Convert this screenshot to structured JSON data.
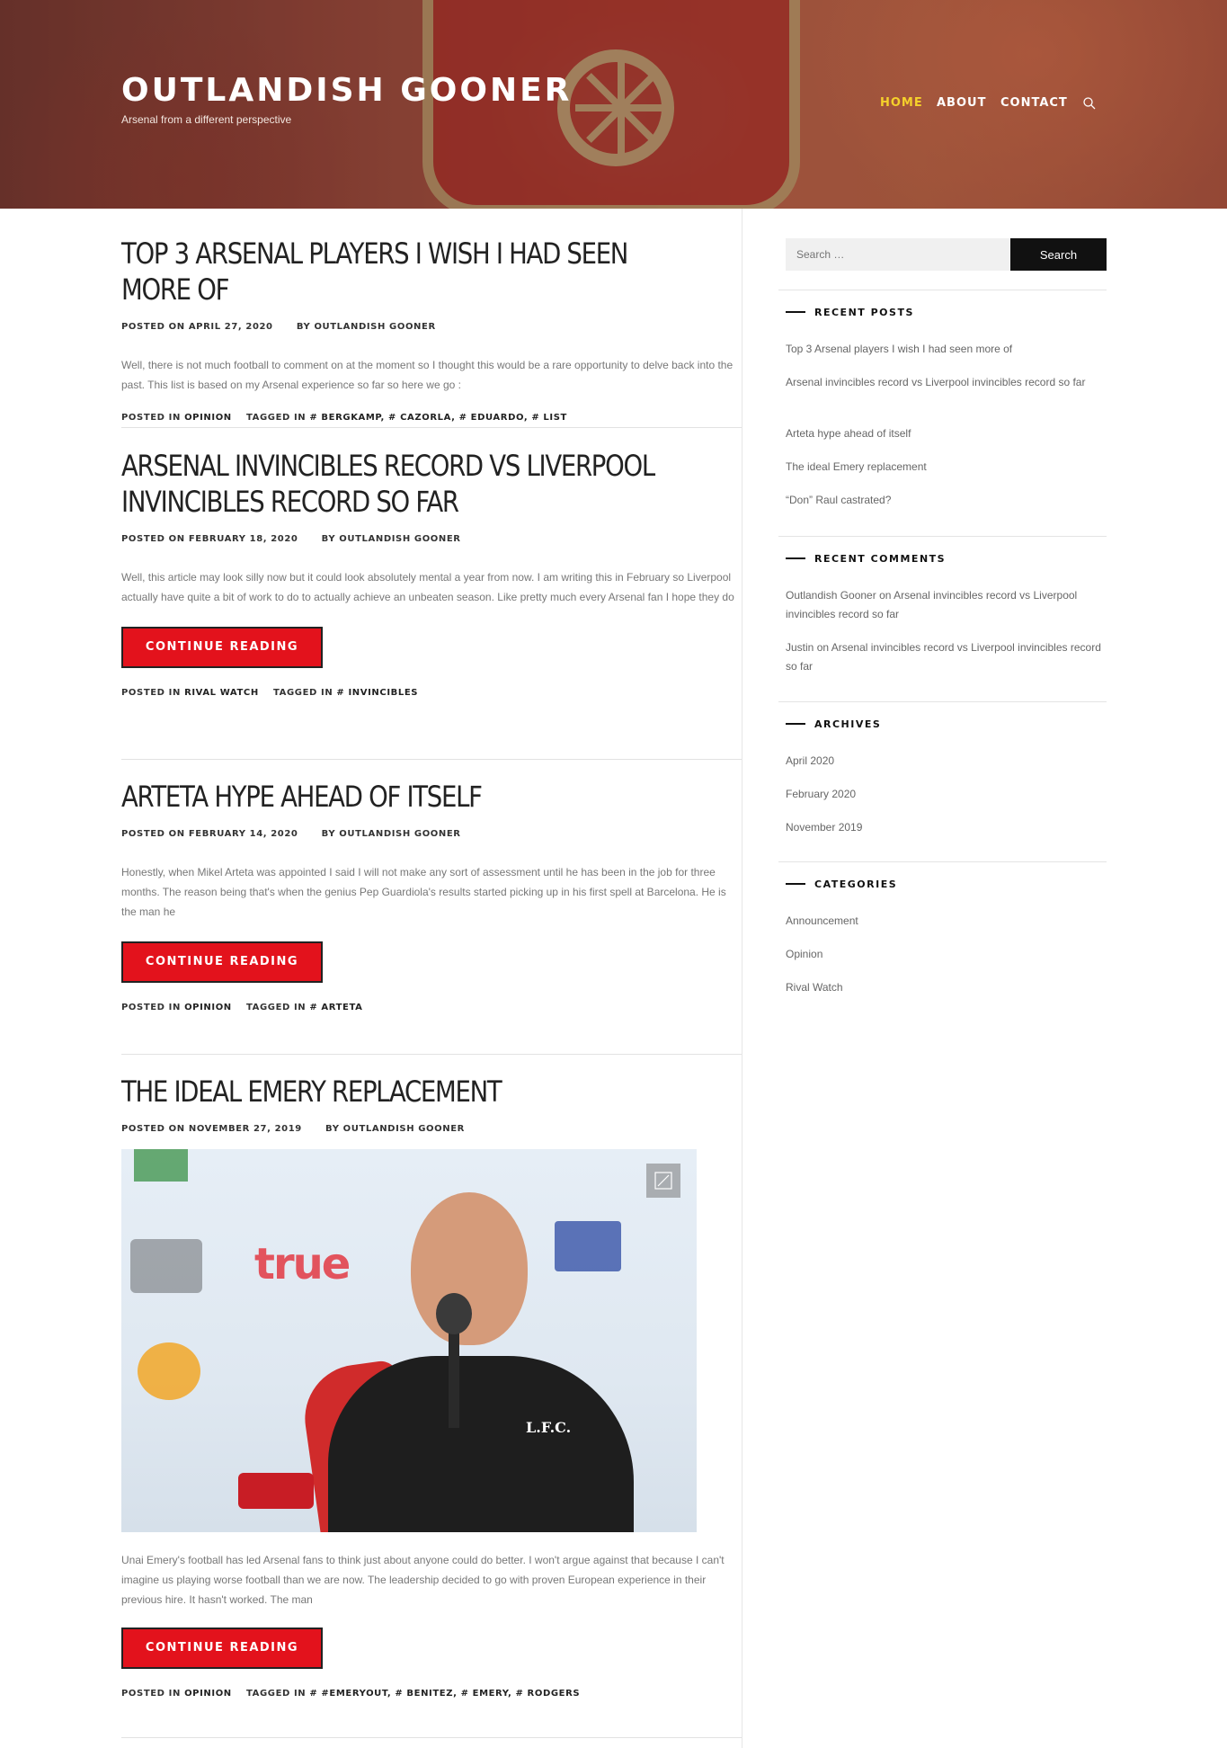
{
  "site": {
    "title": "OUTLANDISH GOONER",
    "tagline": "Arsenal from a different perspective"
  },
  "nav": {
    "items": [
      {
        "label": "HOME",
        "active": true
      },
      {
        "label": "ABOUT",
        "active": false
      },
      {
        "label": "CONTACT",
        "active": false
      }
    ],
    "search_icon": "search-icon",
    "active_color": "#f5d12b"
  },
  "posts": [
    {
      "title": "TOP 3 ARSENAL PLAYERS I WISH I HAD SEEN MORE OF",
      "posted_on_label": "POSTED ON",
      "date": "APRIL 27, 2020",
      "by_label": "BY",
      "author": "OUTLANDISH GOONER",
      "excerpt": "Well, there is not much football to comment on at the moment so I thought this would be a rare opportunity to delve back into the past. This list is based on my Arsenal experience so far so here we go :",
      "posted_in_label": "POSTED IN",
      "category": "OPINION",
      "tagged_in_label": "TAGGED IN",
      "tags": [
        "# BERGKAMP,",
        "# CAZORLA,",
        "# EDUARDO,",
        "# LIST"
      ]
    },
    {
      "title": "ARSENAL INVINCIBLES RECORD VS LIVERPOOL INVINCIBLES RECORD SO FAR",
      "posted_on_label": "POSTED ON",
      "date": "FEBRUARY 18, 2020",
      "by_label": "BY",
      "author": "OUTLANDISH GOONER",
      "excerpt": "Well, this article may look silly now but it could look absolutely mental a year from now. I am writing this in February so Liverpool actually have quite a bit of work to do to actually achieve an unbeaten season. Like pretty much every Arsenal fan I hope they do",
      "read_more": "CONTINUE READING",
      "posted_in_label": "POSTED IN",
      "category": "RIVAL WATCH",
      "tagged_in_label": "TAGGED IN",
      "tags": [
        "# INVINCIBLES"
      ]
    },
    {
      "title": "ARTETA HYPE AHEAD OF ITSELF",
      "posted_on_label": "POSTED ON",
      "date": "FEBRUARY 14, 2020",
      "by_label": "BY",
      "author": "OUTLANDISH GOONER",
      "excerpt": "Honestly, when Mikel Arteta was appointed I said I will not make any sort of assessment until he has been in the job for three months. The reason being that's when the genius Pep Guardiola's results started picking up in his first spell at Barcelona. He is the man he",
      "read_more": "CONTINUE READING",
      "posted_in_label": "POSTED IN",
      "category": "OPINION",
      "tagged_in_label": "TAGGED IN",
      "tags": [
        "# ARTETA"
      ]
    },
    {
      "title": "THE IDEAL EMERY REPLACEMENT",
      "posted_on_label": "POSTED ON",
      "date": "NOVEMBER 27, 2019",
      "by_label": "BY",
      "author": "OUTLANDISH GOONER",
      "image_text": {
        "sponsor": "true",
        "crest": "L.F.C."
      },
      "excerpt": "Unai Emery's football has led Arsenal fans to think just about anyone could do better. I won't argue against that because I can't imagine us playing worse football than we are now. The leadership decided to go with proven European experience in their previous hire. It hasn't worked. The man",
      "read_more": "CONTINUE READING",
      "posted_in_label": "POSTED IN",
      "category": "OPINION",
      "tagged_in_label": "TAGGED IN",
      "tags": [
        "# #EMERYOUT,",
        "# BENITEZ,",
        "# EMERY,",
        "# RODGERS"
      ]
    }
  ],
  "sidebar": {
    "search": {
      "placeholder": "Search …",
      "button": "Search"
    },
    "recent_posts": {
      "title": "RECENT POSTS",
      "items": [
        "Top 3 Arsenal players I wish I had seen more of",
        "Arsenal invincibles record vs Liverpool invincibles record so far",
        "Arteta hype ahead of itself",
        "The ideal Emery replacement",
        "“Don” Raul castrated?"
      ]
    },
    "recent_comments": {
      "title": "RECENT COMMENTS",
      "items": [
        {
          "author": "Outlandish Gooner",
          "on": "on",
          "post": "Arsenal invincibles record vs Liverpool invincibles record so far"
        },
        {
          "author": "Justin",
          "on": "on",
          "post": "Arsenal invincibles record vs Liverpool invincibles record so far"
        }
      ]
    },
    "archives": {
      "title": "ARCHIVES",
      "items": [
        "April 2020",
        "February 2020",
        "November 2019"
      ]
    },
    "categories": {
      "title": "CATEGORIES",
      "items": [
        "Announcement",
        "Opinion",
        "Rival Watch"
      ]
    }
  },
  "colors": {
    "accent_red": "#e3121c",
    "button_border": "#222222",
    "link_gray": "#666666"
  }
}
